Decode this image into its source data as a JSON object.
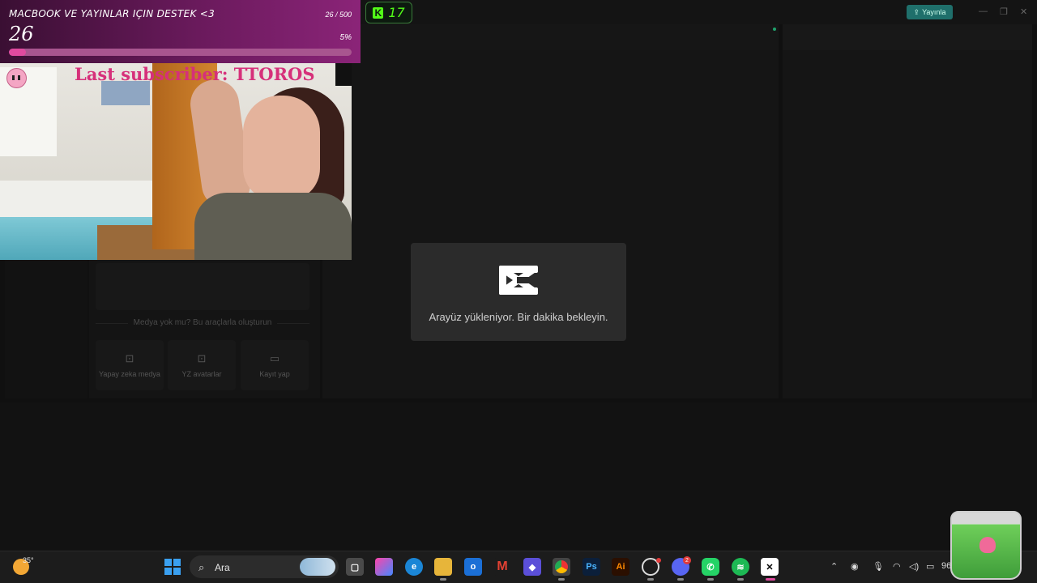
{
  "capcut": {
    "publish_label": "Yayınla",
    "loading_text": "Arayüz yükleniyor. Bir dakika bekleyin.",
    "media": {
      "hint": "Medya yok mu? Bu araçlarla oluşturun",
      "tools": [
        {
          "label": "Yapay zeka medya",
          "icon": "ai-media-icon"
        },
        {
          "label": "YZ avatarlar",
          "icon": "ai-avatar-icon"
        },
        {
          "label": "Kayıt yap",
          "icon": "record-icon"
        }
      ]
    }
  },
  "overlay": {
    "goal_title": "MACBOOK VE YAYINLAR IÇIN DESTEK <3",
    "goal_current": "26",
    "goal_of": "26 / 500",
    "goal_percent_label": "5%",
    "goal_progress": 0.05,
    "kick_viewers": "17",
    "last_subscriber": "Last subscriber: TTOROS"
  },
  "taskbar": {
    "temperature": "35°",
    "search_placeholder": "Ara",
    "battery_pct": "96"
  },
  "colors": {
    "accent": "#1f6f6b",
    "kick_green": "#53fc18",
    "goal_fill": "#e04a9f",
    "subscriber_text": "#d6307a"
  }
}
